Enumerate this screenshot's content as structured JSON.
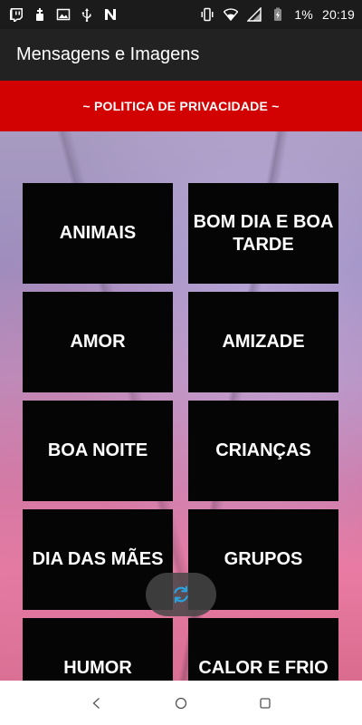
{
  "status_bar": {
    "battery_percent": "1%",
    "time": "20:19",
    "left_icons": [
      "twitch-icon",
      "usb-debug-icon",
      "image-icon",
      "usb-icon",
      "n-app-icon"
    ],
    "right_icons": [
      "vibrate-icon",
      "wifi-icon",
      "signal-icon",
      "battery-charging-icon"
    ]
  },
  "app_bar": {
    "title": "Mensagens e Imagens"
  },
  "privacy_banner": {
    "label": "~ POLITICA DE PRIVACIDADE ~"
  },
  "categories": [
    {
      "label": "ANIMAIS"
    },
    {
      "label": "BOM DIA E BOA TARDE"
    },
    {
      "label": "AMOR"
    },
    {
      "label": "AMIZADE"
    },
    {
      "label": "BOA NOITE"
    },
    {
      "label": "CRIANÇAS"
    },
    {
      "label": "DIA DAS MÃES"
    },
    {
      "label": "GRUPOS"
    },
    {
      "label": "HUMOR"
    },
    {
      "label": "CALOR E FRIO"
    }
  ],
  "refresh_button": {
    "icon": "refresh-icon",
    "color": "#29a3e0"
  },
  "nav_bar": {
    "buttons": [
      "back-icon",
      "home-icon",
      "recents-icon"
    ]
  },
  "colors": {
    "banner": "#d20202",
    "app_bar": "#222222",
    "tile": "#050505"
  }
}
